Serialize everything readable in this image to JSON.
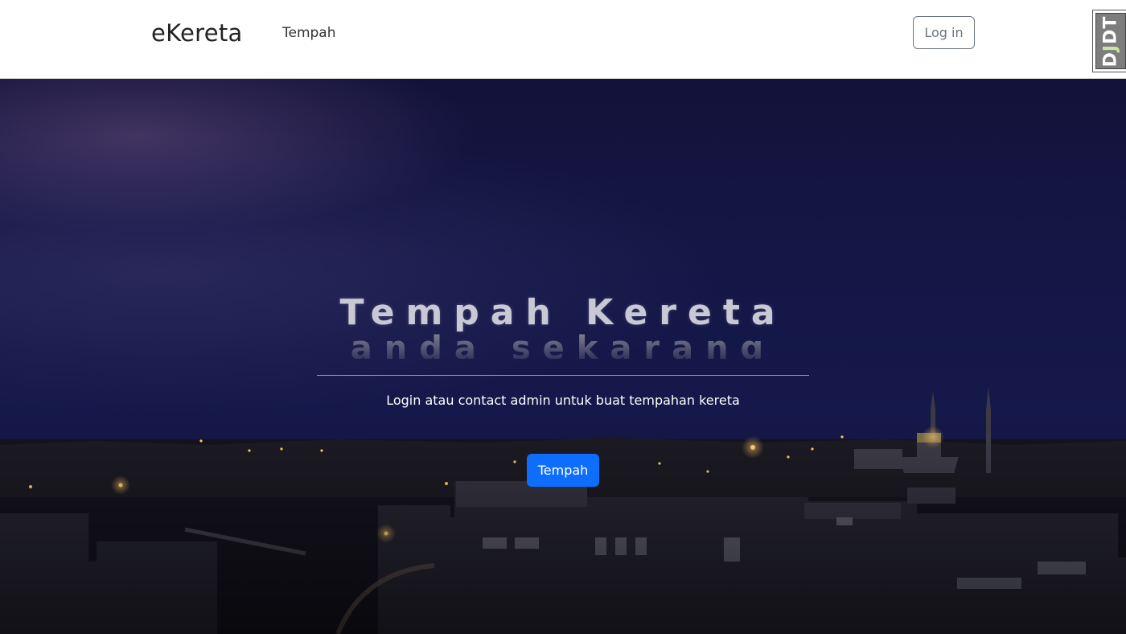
{
  "navbar": {
    "brand": "eKereta",
    "links": [
      {
        "label": "Tempah"
      }
    ],
    "login_label": "Log in",
    "badge_text_main": "D",
    "badge_text_accent": "J",
    "badge_text_end": "DT"
  },
  "hero": {
    "title": "Tempah Kereta",
    "subtitle": "anda sekarang",
    "description": "Login atau contact admin untuk buat tempahan kereta",
    "cta_label": "Tempah"
  },
  "colors": {
    "primary": "#0d6efd",
    "hero_sky": "#141746",
    "secondary": "#6c757d"
  }
}
